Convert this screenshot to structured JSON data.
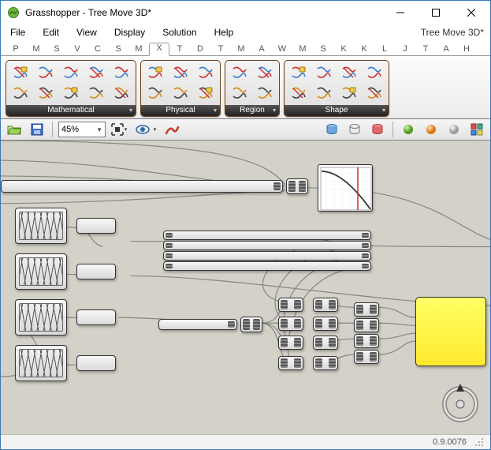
{
  "window": {
    "title": "Grasshopper - Tree Move 3D*",
    "doc_right": "Tree Move 3D*"
  },
  "menu": {
    "items": [
      "File",
      "Edit",
      "View",
      "Display",
      "Solution",
      "Help"
    ]
  },
  "tabs": {
    "items": [
      "P",
      "M",
      "S",
      "V",
      "C",
      "S",
      "M",
      "X",
      "T",
      "D",
      "T",
      "M",
      "A",
      "W",
      "M",
      "S",
      "K",
      "K",
      "L",
      "J",
      "T",
      "A",
      "H"
    ],
    "active_index": 7
  },
  "ribbon": {
    "panels": [
      {
        "label": "Mathematical",
        "cols": 5
      },
      {
        "label": "Physical",
        "cols": 3
      },
      {
        "label": "Region",
        "cols": 2
      },
      {
        "label": "Shape",
        "cols": 4
      }
    ]
  },
  "canvas_toolbar": {
    "zoom": "45%"
  },
  "status": {
    "version": "0.9.0076"
  }
}
